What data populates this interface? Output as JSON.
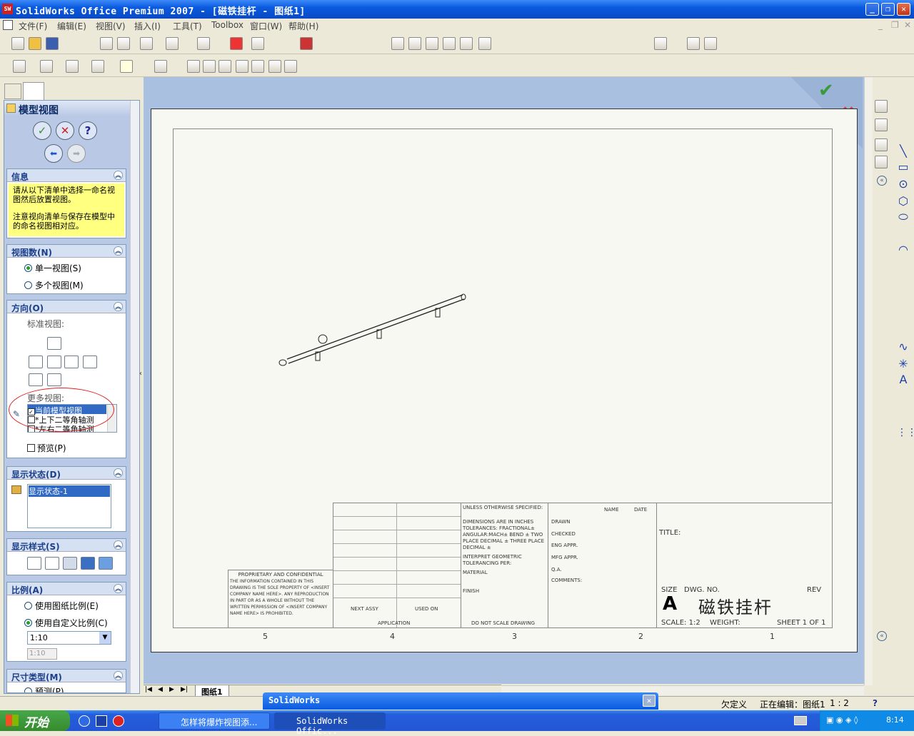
{
  "app": {
    "title": "SolidWorks Office Premium 2007 - [磁铁挂杆 - 图纸1]"
  },
  "menu": [
    "文件(F)",
    "编辑(E)",
    "视图(V)",
    "插入(I)",
    "工具(T)",
    "Toolbox",
    "窗口(W)",
    "帮助(H)"
  ],
  "pm": {
    "title": "模型视图",
    "info": {
      "header": "信息",
      "line1": "请从以下清单中选择一命名视图然后放置视图。",
      "line2": "注意视向清单与保存在模型中的命名视图相对应。"
    },
    "views_count": {
      "header": "视图数(N)",
      "single": "单一视图(S)",
      "multi": "多个视图(M)"
    },
    "orientation": {
      "header": "方向(O)",
      "standard": "标准视图:",
      "more": "更多视图:",
      "items": [
        "当前模型视图",
        "*上下二等角轴测",
        "*左右二等角轴测"
      ],
      "preview": "预览(P)"
    },
    "display_state": {
      "header": "显示状态(D)",
      "item": "显示状态-1"
    },
    "display_style": {
      "header": "显示样式(S)"
    },
    "scale": {
      "header": "比例(A)",
      "sheet": "使用图纸比例(E)",
      "custom": "使用自定义比例(C)",
      "value": "1:10",
      "value2": "1:10"
    },
    "dim_type": {
      "header": "尺寸类型(M)",
      "projected": "预测(P)"
    }
  },
  "sheet": {
    "tab": "图纸1",
    "zones": [
      "5",
      "4",
      "3",
      "2",
      "1"
    ],
    "title_block": {
      "unless": "UNLESS OTHERWISE SPECIFIED:",
      "name": "NAME",
      "date": "DATE",
      "dims": "DIMENSIONS ARE IN INCHES TOLERANCES: FRACTIONAL± ANGULAR:MACH± BEND ± TWO PLACE DECIMAL ± THREE PLACE DECIMAL ±",
      "drawn": "DRAWN",
      "checked": "CHECKED",
      "eng": "ENG APPR.",
      "mfg": "MFG APPR.",
      "qa": "Q.A.",
      "comments": "COMMENTS:",
      "interp": "INTERPRET GEOMETRIC TOLERANCING PER:",
      "material": "MATERIAL",
      "finish": "FINISH",
      "next": "NEXT ASSY",
      "used": "USED ON",
      "application": "APPLICATION",
      "noscale": "DO NOT SCALE DRAWING",
      "title": "TITLE:",
      "size": "SIZE",
      "size_val": "A",
      "dwg": "DWG. NO.",
      "dwg_val": "磁铁挂杆",
      "rev": "REV",
      "scale": "SCALE: 1:2",
      "weight": "WEIGHT:",
      "sheet_of": "SHEET 1 OF 1",
      "prop": "PROPRIETARY AND CONFIDENTIAL",
      "prop_text": "THE INFORMATION CONTAINED IN THIS DRAWING IS THE SOLE PROPERTY OF <INSERT COMPANY NAME HERE>. ANY REPRODUCTION IN PART OR AS A WHOLE WITHOUT THE WRITTEN PERMISSION OF <INSERT COMPANY NAME HERE> IS PROHIBITED."
    }
  },
  "status": {
    "floating": "SolidWorks",
    "defined": "欠定义",
    "editing": "正在编辑：图纸1",
    "scale": "1 : 2",
    "help": "?"
  },
  "taskbar": {
    "start": "开始",
    "task1": "怎样将爆炸视图添...",
    "task2": "SolidWorks Offic...",
    "time": "8:14"
  }
}
